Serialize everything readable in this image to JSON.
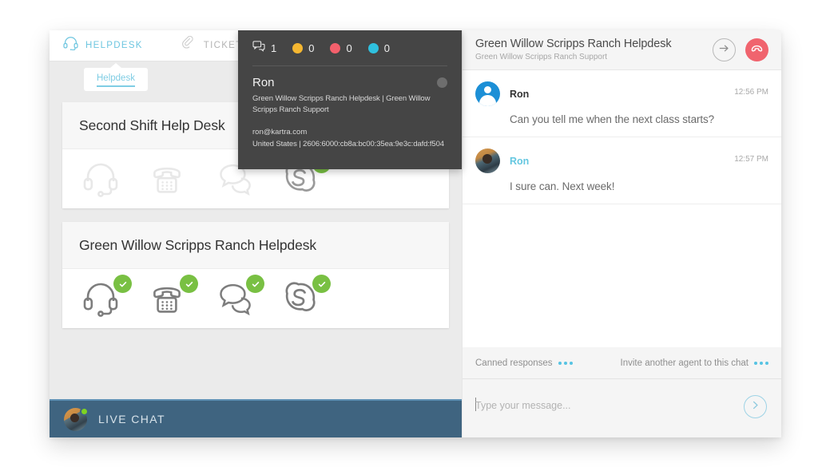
{
  "topnav": {
    "items": [
      {
        "label": "HELPDESK",
        "icon": "headset-icon",
        "active": true
      },
      {
        "label": "TICKETS",
        "icon": "paperclip-icon",
        "active": false
      }
    ]
  },
  "subtab": {
    "label": "Helpdesk"
  },
  "departments": [
    {
      "title": "Second Shift Help Desk",
      "channels": [
        {
          "icon": "headset-icon",
          "enabled": false
        },
        {
          "icon": "phone-icon",
          "enabled": false
        },
        {
          "icon": "chat-bubbles-icon",
          "enabled": false
        },
        {
          "icon": "skype-icon",
          "enabled": true
        }
      ]
    },
    {
      "title": "Green Willow Scripps Ranch Helpdesk",
      "channels": [
        {
          "icon": "headset-icon",
          "enabled": true
        },
        {
          "icon": "phone-icon",
          "enabled": true
        },
        {
          "icon": "chat-bubbles-icon",
          "enabled": true
        },
        {
          "icon": "skype-icon",
          "enabled": true
        }
      ]
    }
  ],
  "livechat_bar": {
    "label": "LIVE CHAT",
    "status": "online"
  },
  "contact_panel": {
    "counters": [
      {
        "icon": "chat-count-icon",
        "color": "#ffffff",
        "value": "1"
      },
      {
        "icon": "status-dot-icon",
        "color": "#f5b731",
        "value": "0"
      },
      {
        "icon": "status-dot-icon",
        "color": "#f4606c",
        "value": "0"
      },
      {
        "icon": "status-dot-icon",
        "color": "#2fc0de",
        "value": "0"
      }
    ],
    "name": "Ron",
    "departments": "Green Willow Scripps Ranch Helpdesk  |  Green Willow Scripps Ranch Support",
    "email": "ron@kartra.com",
    "geo": "United States   |   2606:6000:cb8a:bc00:35ea:9e3c:dafd:f504"
  },
  "chat": {
    "title": "Green Willow Scripps Ranch Helpdesk",
    "subtitle": "Green Willow Scripps Ranch Support",
    "transfer_icon": "arrow-right-circle-icon",
    "end_icon": "hang-up-phone-icon",
    "messages": [
      {
        "author": "Ron",
        "role": "visitor",
        "time": "12:56 PM",
        "text": "Can you tell me when the next class starts?",
        "avatar": "default-user-avatar"
      },
      {
        "author": "Ron",
        "role": "agent",
        "time": "12:57 PM",
        "text": "I sure can. Next week!",
        "avatar": "agent-photo-avatar"
      }
    ],
    "footer": {
      "canned_responses": "Canned responses",
      "invite_agent": "Invite another agent to this chat",
      "composer_placeholder": "Type your message...",
      "composer_value": "",
      "send_icon": "send-arrow-icon"
    }
  },
  "colors": {
    "accent_cyan": "#6ec6e0",
    "green_check": "#79c043",
    "red_end": "#f0646e",
    "dark_panel": "#454545",
    "livechat_bar": "#3f6480"
  }
}
